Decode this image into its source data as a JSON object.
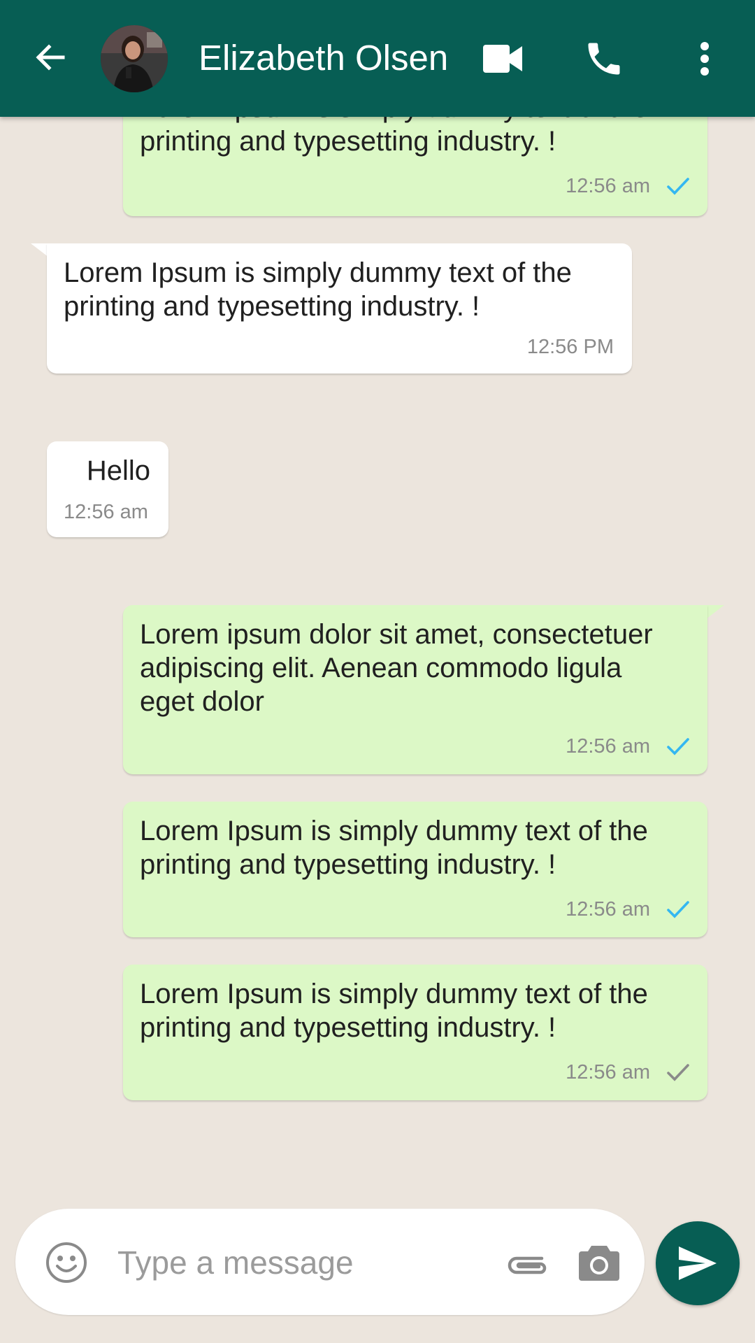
{
  "colors": {
    "header_bg": "#075e54",
    "chat_bg": "#ece5dd",
    "outgoing_bubble": "#dcf8c6",
    "incoming_bubble": "#ffffff",
    "read_tick": "#34b7f1",
    "sent_tick": "#8a8a8a",
    "send_button": "#075e54"
  },
  "header": {
    "back_icon": "arrow-left-icon",
    "avatar_icon": "contact-avatar",
    "contact_name": "Elizabeth Olsen",
    "video_icon": "video-camera-icon",
    "call_icon": "phone-icon",
    "menu_icon": "more-vertical-icon"
  },
  "messages": [
    {
      "direction": "outgoing",
      "text": "Lorem Ipsum is simply dummy text of the\nprinting and typesetting industry. !",
      "time": "12:56 am",
      "status": "read"
    },
    {
      "direction": "incoming",
      "text": "Lorem Ipsum is simply dummy text of the\nprinting and typesetting industry. !",
      "time": "12:56 PM"
    },
    {
      "direction": "incoming",
      "text": "Hello",
      "time": "12:56 am"
    },
    {
      "direction": "outgoing",
      "text": "Lorem ipsum dolor sit amet, consectetuer\nadipiscing elit. Aenean commodo ligula\neget dolor",
      "time": "12:56 am",
      "status": "read"
    },
    {
      "direction": "outgoing",
      "text": "Lorem Ipsum is simply dummy text of the\nprinting and typesetting industry. !",
      "time": "12:56 am",
      "status": "read"
    },
    {
      "direction": "outgoing",
      "text": "Lorem Ipsum is simply dummy text of the\nprinting and typesetting industry. !",
      "time": "12:56 am",
      "status": "sent"
    }
  ],
  "composer": {
    "emoji_icon": "smiley-icon",
    "placeholder": "Type a message",
    "value": "",
    "attach_icon": "paperclip-icon",
    "camera_icon": "camera-icon",
    "send_icon": "send-icon"
  }
}
